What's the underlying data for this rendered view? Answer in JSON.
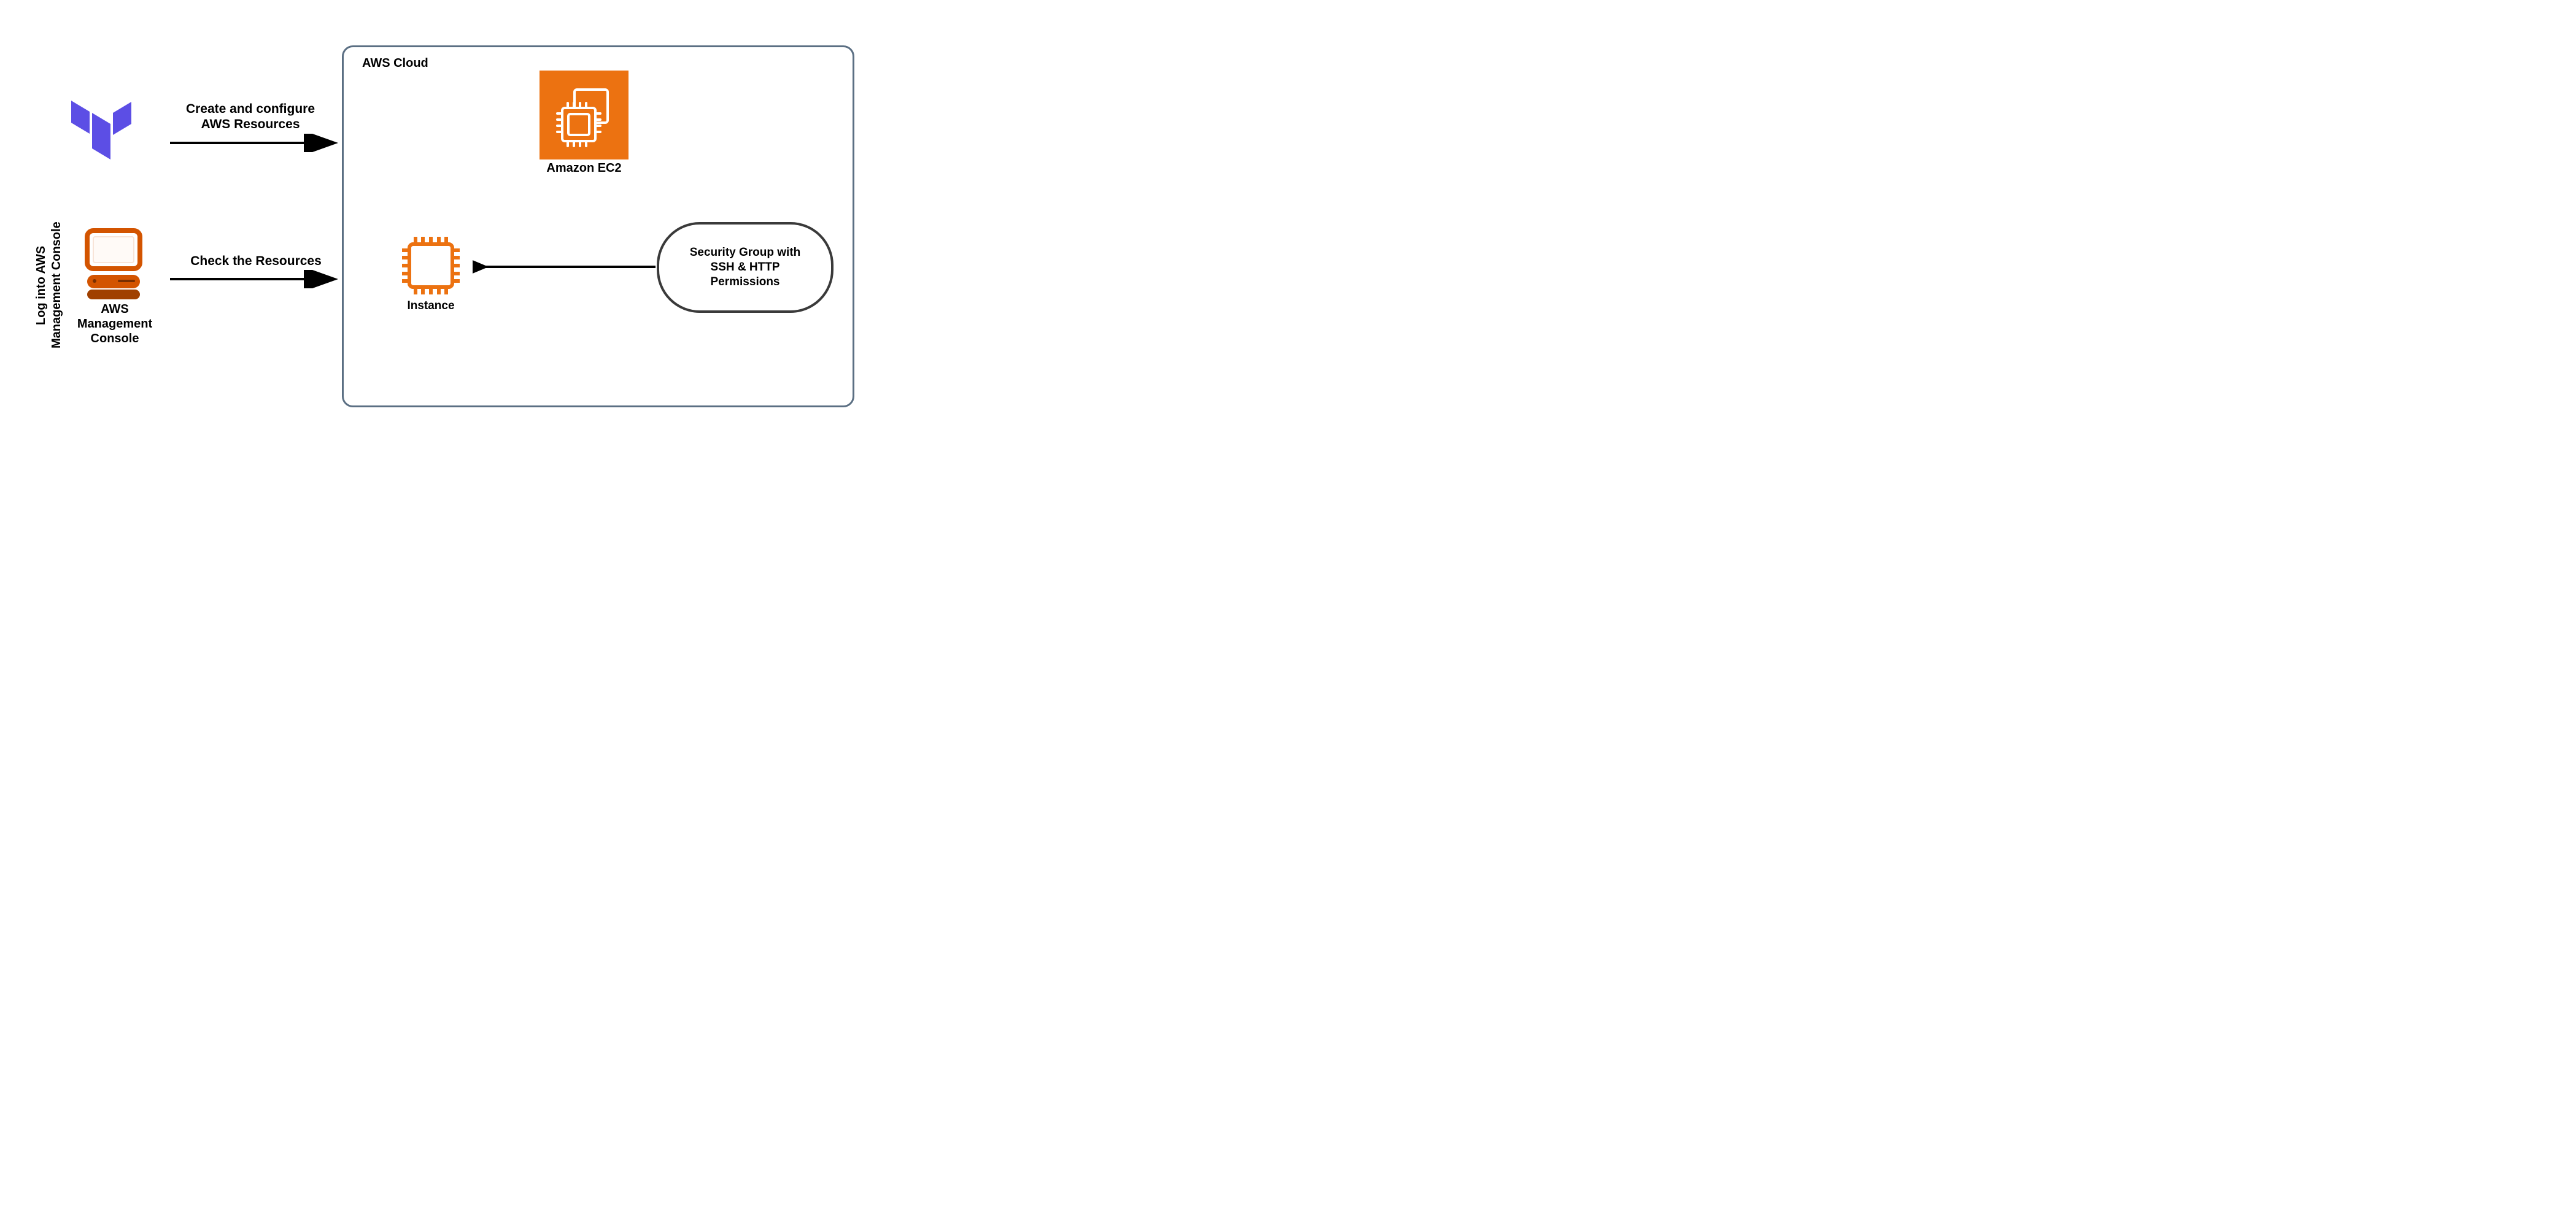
{
  "cloud": {
    "title": "AWS Cloud"
  },
  "ec2": {
    "label": "Amazon EC2"
  },
  "instance": {
    "label": "Instance"
  },
  "security_group": {
    "line1": "Security Group with",
    "line2": "SSH & HTTP",
    "line3": "Permissions"
  },
  "console": {
    "line1": "AWS",
    "line2": "Management",
    "line3": "Console"
  },
  "rotated_label": {
    "line1": "Log into AWS",
    "line2": "Management Console"
  },
  "arrows": {
    "create": {
      "line1": "Create and configure",
      "line2": "AWS Resources"
    },
    "check": {
      "line1": "Check the Resources"
    }
  },
  "colors": {
    "aws_orange": "#ec7211",
    "terraform_purple": "#5c4ee5",
    "cloud_border": "#5b6f83",
    "sg_border": "#3a3a3a"
  }
}
